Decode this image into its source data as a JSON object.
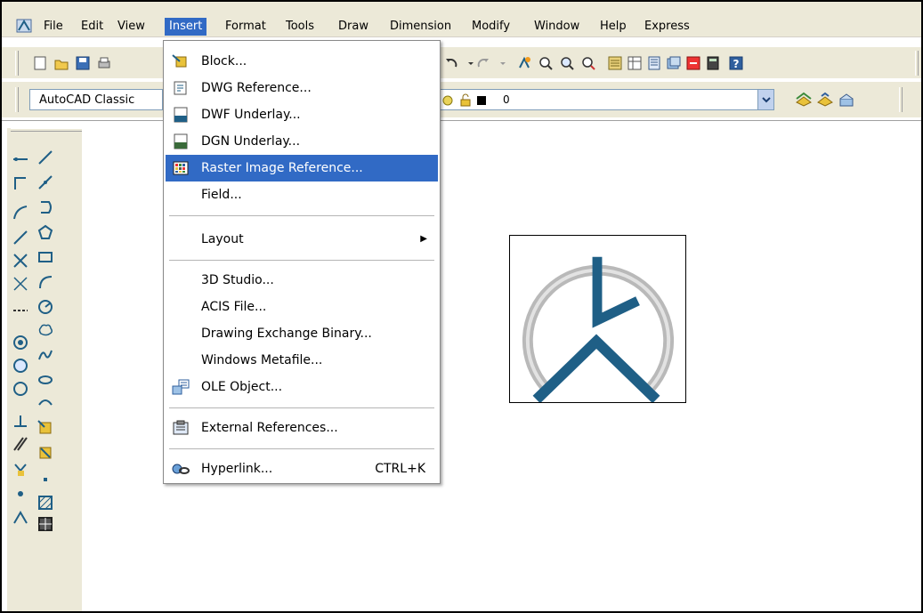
{
  "menubar": {
    "items": [
      "File",
      "Edit",
      "View",
      "Insert",
      "Format",
      "Tools",
      "Draw",
      "Dimension",
      "Modify",
      "Window",
      "Help",
      "Express"
    ],
    "active": "Insert"
  },
  "toolbar": {
    "workspace": "AutoCAD Classic",
    "layer": "0"
  },
  "insert_menu": {
    "items": [
      {
        "label": "Block...",
        "icon": "block-insert-icon",
        "shortcut": ""
      },
      {
        "label": "DWG Reference...",
        "icon": "dwg-reference-icon",
        "shortcut": ""
      },
      {
        "label": "DWF Underlay...",
        "icon": "dwf-underlay-icon",
        "shortcut": ""
      },
      {
        "label": "DGN Underlay...",
        "icon": "dgn-underlay-icon",
        "shortcut": ""
      },
      {
        "label": "Raster Image Reference...",
        "icon": "raster-image-icon",
        "shortcut": ""
      },
      {
        "label": "Field...",
        "icon": "",
        "shortcut": ""
      },
      {
        "label": "Layout",
        "icon": "",
        "shortcut": ""
      },
      {
        "label": "3D Studio...",
        "icon": "",
        "shortcut": ""
      },
      {
        "label": "ACIS File...",
        "icon": "",
        "shortcut": ""
      },
      {
        "label": "Drawing Exchange Binary...",
        "icon": "",
        "shortcut": ""
      },
      {
        "label": "Windows Metafile...",
        "icon": "",
        "shortcut": ""
      },
      {
        "label": "OLE Object...",
        "icon": "ole-object-icon",
        "shortcut": ""
      },
      {
        "label": "External References...",
        "icon": "external-references-icon",
        "shortcut": ""
      },
      {
        "label": "Hyperlink...",
        "icon": "hyperlink-icon",
        "shortcut": "CTRL+K"
      }
    ],
    "highlighted": "Raster Image Reference..."
  },
  "colors": {
    "menu_highlight": "#316ac5",
    "toolbar_bg": "#ece9d8",
    "clock_blue": "#1f5f86",
    "clock_gray": "#b9b9b9"
  }
}
